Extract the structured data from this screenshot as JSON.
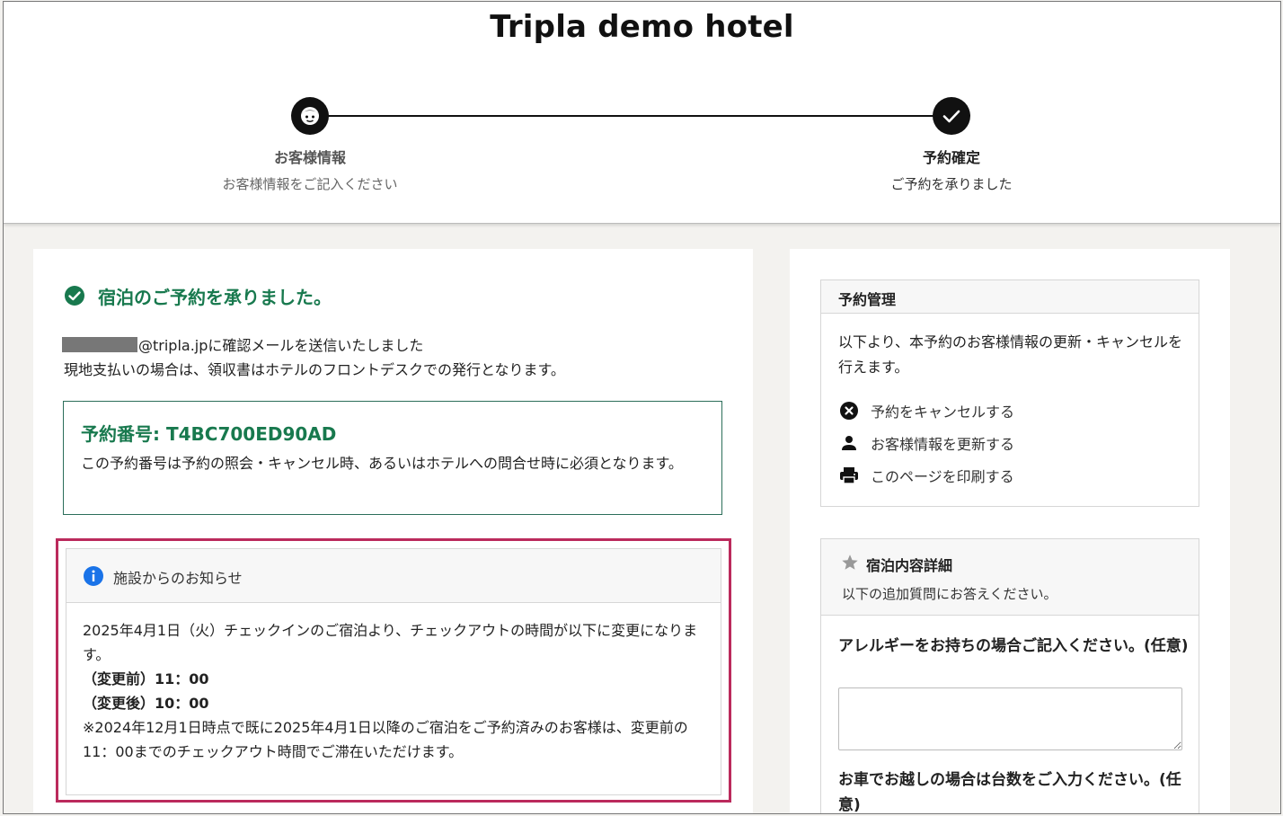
{
  "header": {
    "hotel_name": "Tripla demo hotel",
    "steps": [
      {
        "title": "お客様情報",
        "subtitle": "お客様情報をご記入ください",
        "state": "previous"
      },
      {
        "title": "予約確定",
        "subtitle": "ご予約を承りました",
        "state": "current-complete"
      }
    ]
  },
  "confirmation": {
    "success_message": "宿泊のご予約を承りました。",
    "email_suffix": "@tripla.jpに確認メールを送信いたしました",
    "receipt_note": "現地支払いの場合は、領収書はホテルのフロントデスクでの発行となります。",
    "reservation_number_label": "予約番号: T4BC700ED90AD",
    "reservation_number_note": "この予約番号は予約の照会・キャンセル時、あるいはホテルへの問合せ時に必須となります。"
  },
  "notice": {
    "title": "施設からのお知らせ",
    "line1": "2025年4月1日（火）チェックインのご宿泊より、チェックアウトの時間が以下に変更になります。",
    "before": "（変更前）11：00",
    "after": "（変更後）10：00",
    "line2": "※2024年12月1日時点で既に2025年4月1日以降のご宿泊をご予約済みのお客様は、変更前の11：00までのチェックアウト時間でご滞在いただけます。"
  },
  "management": {
    "title": "予約管理",
    "description": "以下より、本予約のお客様情報の更新・キャンセルを行えます。",
    "links": [
      {
        "label": "予約をキャンセルする",
        "icon": "cancel-circle-icon"
      },
      {
        "label": "お客様情報を更新する",
        "icon": "person-icon"
      },
      {
        "label": "このページを印刷する",
        "icon": "printer-icon"
      }
    ]
  },
  "details": {
    "title": "宿泊内容詳細",
    "subtitle": "以下の追加質問にお答えください。",
    "q_allergy": "アレルギーをお持ちの場合ご記入ください。(任意)",
    "q_car": "お車でお越しの場合は台数をご入力ください。(任意)",
    "allergy_value": ""
  },
  "colors": {
    "success_green": "#18794e",
    "highlight_border": "#bb2a5c",
    "info_blue": "#1a73e8",
    "step_dark": "#111111"
  }
}
